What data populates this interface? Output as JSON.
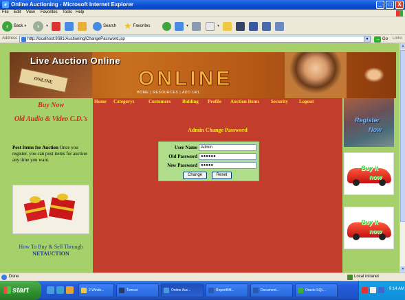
{
  "window": {
    "title": "Online Auctioning - Microsoft Internet Explorer",
    "minimize": "_",
    "maximize": "□",
    "close": "X"
  },
  "menu": [
    "File",
    "Edit",
    "View",
    "Favorites",
    "Tools",
    "Help"
  ],
  "toolbar": {
    "back": "Back",
    "search": "Search",
    "favorites": "Favorites"
  },
  "address": {
    "label": "Address",
    "url": "http://localhost:8081/Auctioning/ChangePassword.jsp",
    "go": "Go",
    "links": "Links"
  },
  "banner": {
    "title": "Live Auction Online",
    "big": "ONLINE",
    "card": "ONLINE",
    "nav": "HOME  |  RESOURCES  |  ADD URL"
  },
  "left": {
    "buy_now": "Buy Now",
    "old_audio": "Old Audio & Video C.D.'s",
    "post_bold": "Post Items for Auction",
    "post_text": " Once you register, you can post items for auction any time you want.",
    "howto_line1": "How To Buy & Sell Through",
    "howto_line2": "NETAUCTION"
  },
  "nav": [
    "Home",
    "Categorys",
    "Customers",
    "Bidding",
    "Profile",
    "Auction Items",
    "Security",
    "Logout"
  ],
  "form": {
    "heading": "Admin Change Password",
    "username_label": "User Name",
    "username_value": "Admin",
    "oldpw_label": "Old Password",
    "oldpw_value": "●●●●●●",
    "newpw_label": "New Password",
    "newpw_value": "●●●●●",
    "change_button": "Change",
    "reset_button": "Reset"
  },
  "right": {
    "register_line1": "Register",
    "register_line2": "Now",
    "buy_it_1": "Buy it",
    "now_1": "now",
    "buy_it_2": "Buy it",
    "now_2": "now"
  },
  "status": {
    "left": "Done",
    "zone": "Local intranet"
  },
  "taskbar": {
    "start": "start",
    "tasks": [
      "2 Windo...",
      "Tomcat",
      "Online Auc...",
      "ReportBM...",
      "Document...",
      "Oracle SQL..."
    ],
    "clock": "9:14 AM"
  }
}
